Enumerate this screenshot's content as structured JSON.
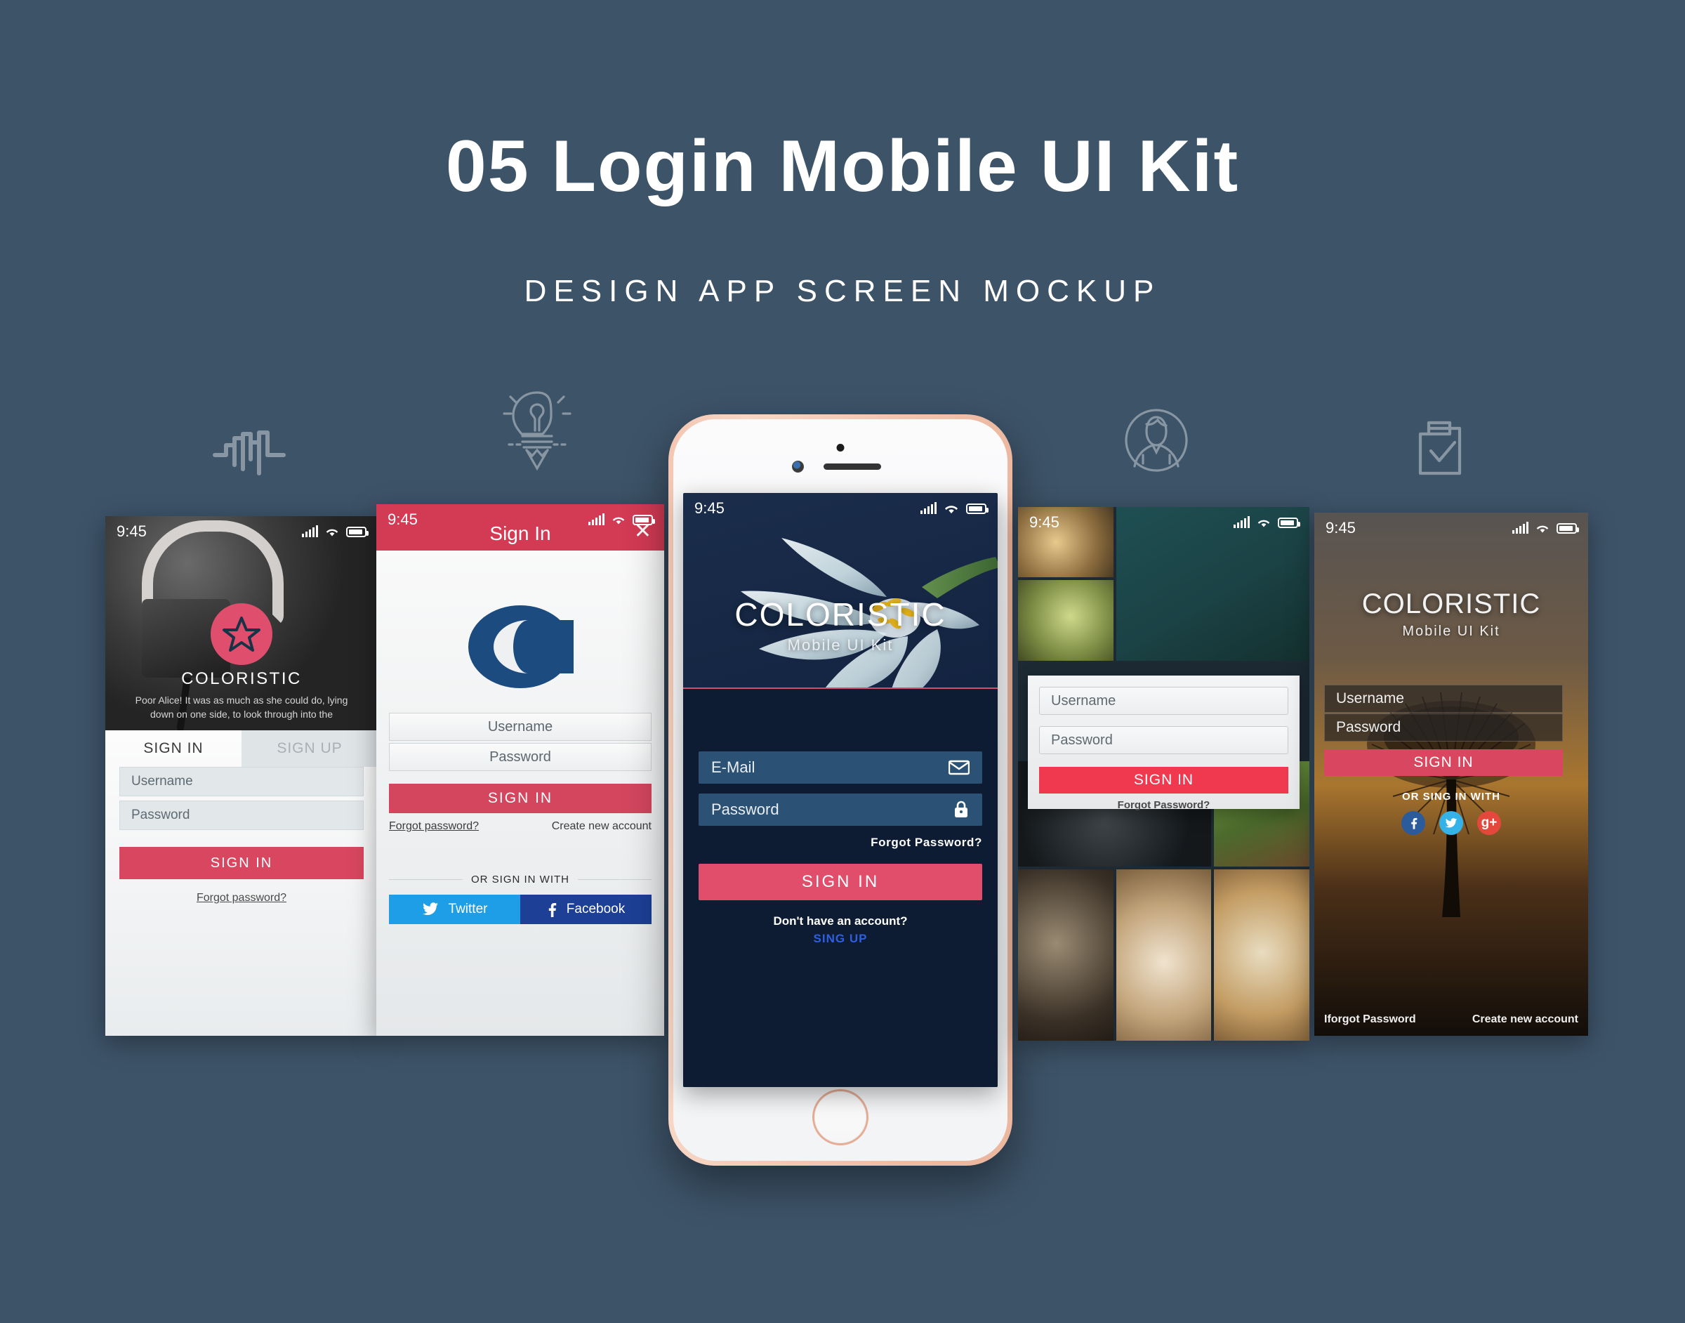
{
  "header": {
    "title": "05 Login Mobile UI Kit",
    "subtitle": "DESIGN APP SCREEN MOCKUP"
  },
  "colors": {
    "background": "#3d5368",
    "accent_pink": "#d8465f",
    "accent_red": "#f0394f",
    "twitter_blue": "#1f9ee8",
    "facebook_blue": "#1d3f95",
    "google_red": "#e4483c",
    "phone_frame_rose_gold": "#f0c6ae",
    "link_blue": "#2f5fe0"
  },
  "deco_icons": [
    {
      "name": "waveform-icon"
    },
    {
      "name": "lightbulb-pencil-icon"
    },
    {
      "name": "user-avatar-icon"
    },
    {
      "name": "clipboard-check-icon"
    }
  ],
  "screens": [
    {
      "id": "screen1",
      "status_time": "9:45",
      "brand": "COLORISTIC",
      "quote": "Poor Alice! It was as much as she could do, lying down on one side, to look through into the",
      "tab_signin": "SIGN IN",
      "tab_signup": "SIGN UP",
      "username": "Username",
      "password": "Password",
      "signin_button": "SIGN  IN",
      "forgot": "Forgot password?"
    },
    {
      "id": "screen2",
      "status_time": "9:45",
      "header_title": "Sign In",
      "close": "✕",
      "logo_letter": "C",
      "username": "Username",
      "password": "Password",
      "signin_button": "SIGN  IN",
      "forgot": "Forgot password?",
      "create_account": "Create  new  account",
      "or_label": "OR SIGN IN WITH",
      "twitter": "Twitter",
      "facebook": "Facebook"
    },
    {
      "id": "screen3",
      "status_time": "9:45",
      "brand": "COLORISTIC",
      "tagline": "Mobile  UI  Kit",
      "email": "E-Mail",
      "password": "Password",
      "forgot": "Forgot  Password?",
      "signin_button": "SIGN  IN",
      "no_account": "Don't have an account?",
      "signup_link": "SING UP"
    },
    {
      "id": "screen4",
      "status_time": "9:45",
      "username": "Username",
      "password": "Password",
      "signin_button": "SIGN IN",
      "forgot": "Forgot Password?"
    },
    {
      "id": "screen5",
      "status_time": "9:45",
      "brand": "COLORISTIC",
      "tagline": "Mobile  UI  Kit",
      "username": "Username",
      "password": "Password",
      "signin_button": "SIGN IN",
      "or_label": "OR SING IN WITH",
      "social_facebook": "f",
      "social_twitter": "ᵕ",
      "social_google": "g+",
      "forgot": "Iforgot Password",
      "create_account": "Create new account"
    }
  ]
}
